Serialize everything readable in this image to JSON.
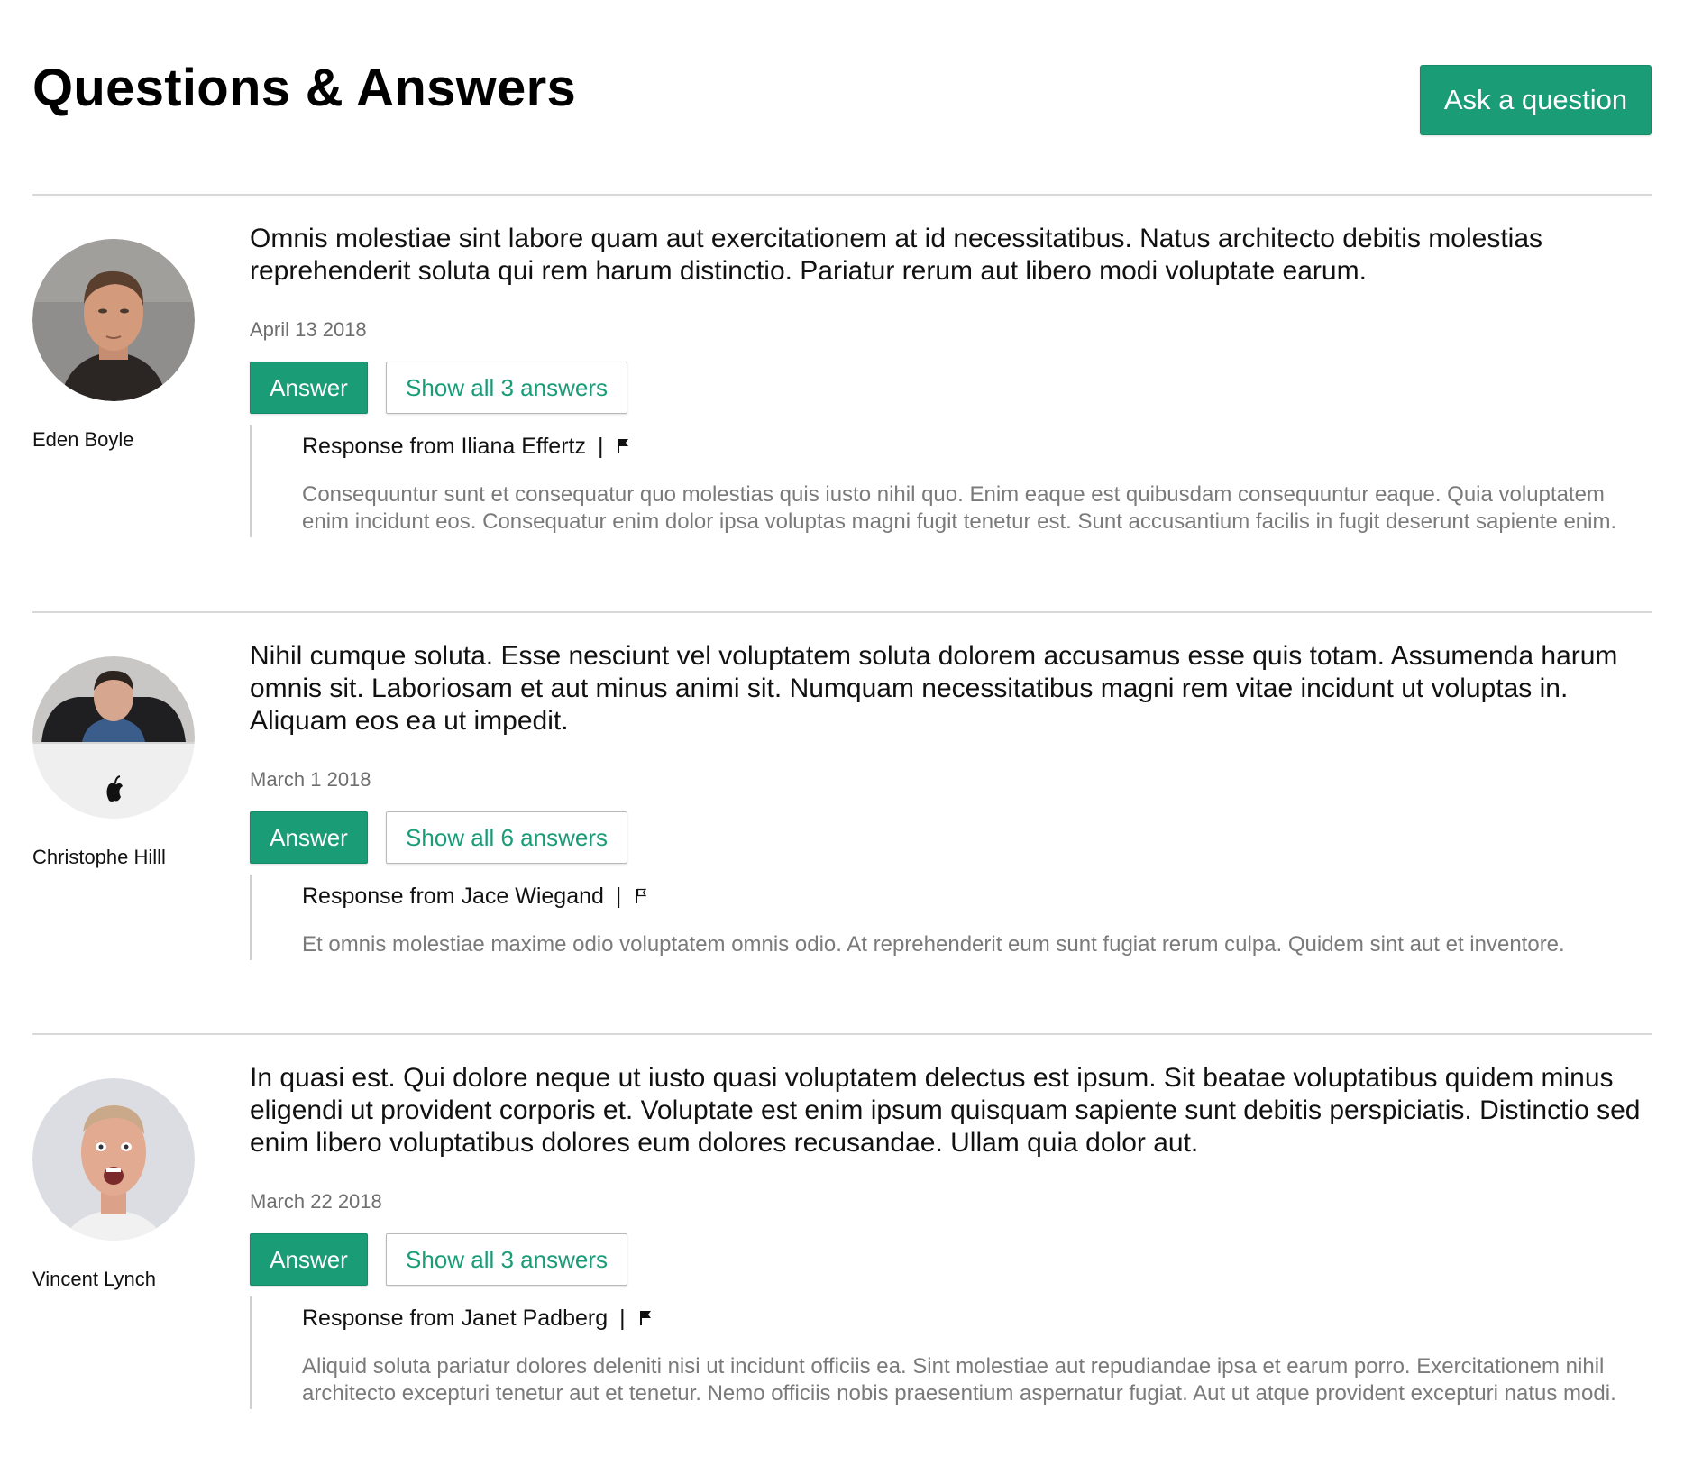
{
  "header": {
    "title": "Questions & Answers",
    "ask_button": "Ask a question"
  },
  "questions": [
    {
      "author": "Eden Boyle",
      "avatar": "person-avatar-man-short-hair",
      "text": "Omnis molestiae sint labore quam aut exercitationem at id necessitatibus. Natus architecto debitis molestias reprehenderit soluta qui rem harum distinctio. Pariatur rerum aut libero modi voluptate earum.",
      "date": "April 13 2018",
      "answer_label": "Answer",
      "show_all_label": "Show all 3 answers",
      "response": {
        "prefix": "Response from",
        "name": "Iliana Effertz",
        "separator": "|",
        "flag_icon": "flag-filled-icon",
        "text": "Consequuntur sunt et consequatur quo molestias quis iusto nihil quo. Enim eaque est quibusdam consequuntur eaque. Quia voluptatem enim incidunt eos. Consequatur enim dolor ipsa voluptas magni fugit tenetur est. Sunt accusantium facilis in fugit deserunt sapiente enim."
      }
    },
    {
      "author": "Christophe Hilll",
      "avatar": "person-avatar-man-at-computer",
      "text": "Nihil cumque soluta. Esse nesciunt vel voluptatem soluta dolorem accusamus esse quis totam. Assumenda harum omnis sit. Laboriosam et aut minus animi sit. Numquam necessitatibus magni rem vitae incidunt ut voluptas in. Aliquam eos ea ut impedit.",
      "date": "March 1 2018",
      "answer_label": "Answer",
      "show_all_label": "Show all 6 answers",
      "response": {
        "prefix": "Response from",
        "name": "Jace Wiegand",
        "separator": "|",
        "flag_icon": "flag-outline-icon",
        "text": "Et omnis molestiae maxime odio voluptatem omnis odio. At reprehenderit eum sunt fugiat rerum culpa. Quidem sint aut et inventore."
      }
    },
    {
      "author": "Vincent Lynch",
      "avatar": "person-avatar-man-surprised",
      "text": "In quasi est. Qui dolore neque ut iusto quasi voluptatem delectus est ipsum. Sit beatae voluptatibus quidem minus eligendi ut provident corporis et. Voluptate est enim ipsum quisquam sapiente sunt debitis perspiciatis. Distinctio sed enim libero voluptatibus dolores eum dolores recusandae. Ullam quia dolor aut.",
      "date": "March 22 2018",
      "answer_label": "Answer",
      "show_all_label": "Show all 3 answers",
      "response": {
        "prefix": "Response from",
        "name": "Janet Padberg",
        "separator": "|",
        "flag_icon": "flag-filled-icon",
        "text": "Aliquid soluta pariatur dolores deleniti nisi ut incidunt officiis ea. Sint molestiae aut repudiandae ipsa et earum porro. Exercitationem nihil architecto excepturi tenetur aut et tenetur. Nemo officiis nobis praesentium aspernatur fugiat. Aut ut atque provident excepturi natus modi."
      }
    }
  ],
  "colors": {
    "accent": "#1a9c77",
    "divider": "#d8d8d8",
    "muted_text": "#7a7a7a",
    "date_text": "#6e6e6e"
  }
}
